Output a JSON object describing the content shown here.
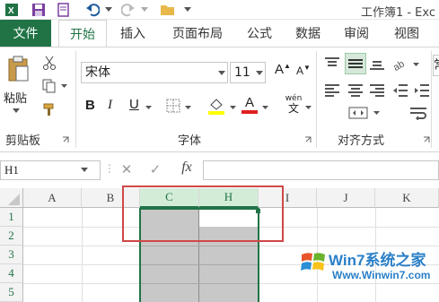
{
  "title": "工作簿1 - Exc",
  "tabs": {
    "file": "文件",
    "items": [
      "开始",
      "插入",
      "页面布局",
      "公式",
      "数据",
      "审阅",
      "视图"
    ]
  },
  "ribbon": {
    "paste_label": "粘贴",
    "font_name": "宋体",
    "font_size": "11",
    "font_grow": "A",
    "font_shrink": "A",
    "bold": "B",
    "italic": "I",
    "underline": "U",
    "font_color_letter": "A",
    "phonetic_top": "wén",
    "phonetic_bottom": "文",
    "clipboard_label": "剪贴板",
    "font_label": "字体",
    "align_label": "对齐方式",
    "number_partial": "常"
  },
  "formula_bar": {
    "name_box": "H1",
    "cancel": "✕",
    "enter": "✓",
    "fx": "fx",
    "value": ""
  },
  "grid": {
    "columns": [
      "A",
      "B",
      "C",
      "H",
      "I",
      "J",
      "K"
    ],
    "selected_columns": [
      "C",
      "H"
    ],
    "rows": [
      "1",
      "2",
      "3",
      "4",
      "5"
    ]
  },
  "watermark": {
    "brand": "Win7系统之家",
    "url": "Www.Winwin7.com"
  },
  "colors": {
    "accent": "#217346",
    "highlight_box": "#d04848",
    "selection_fill": "#c8c8c8"
  }
}
